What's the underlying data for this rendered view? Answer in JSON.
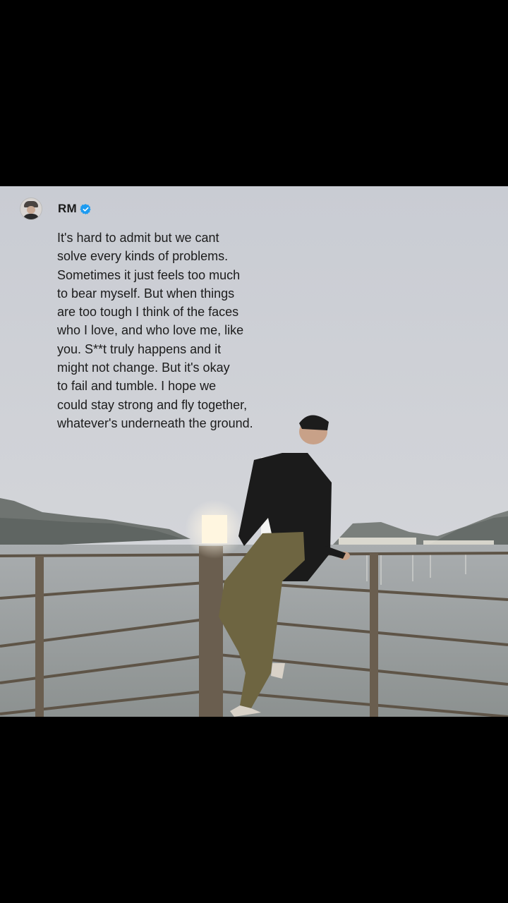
{
  "post": {
    "author": "RM",
    "verified_icon": "verified-badge-icon",
    "accent": "#1d9bf0",
    "lines": [
      "It's hard to admit but we cant",
      "solve every kinds of problems.",
      "Sometimes it just feels too much",
      "to bear myself. But when things",
      "are too tough I think of the faces",
      "who I love, and who love me, like",
      "you. S**t truly happens and it",
      "might not change. But it's okay",
      "to fail and tumble. I hope we",
      "could stay strong and fly together,",
      "whatever's underneath the ground."
    ]
  }
}
